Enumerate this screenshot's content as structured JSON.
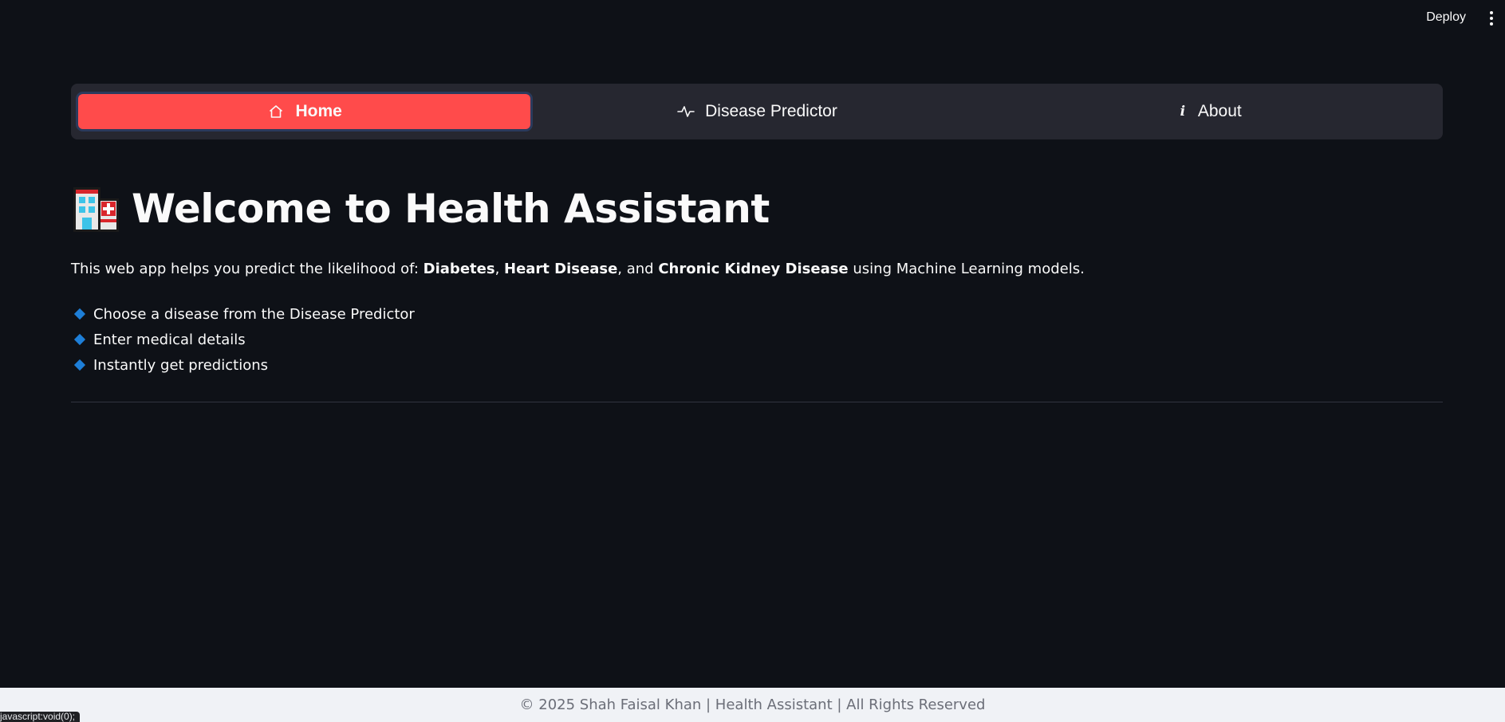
{
  "header": {
    "deploy_label": "Deploy",
    "menu_icon": "kebab-menu-icon"
  },
  "nav": {
    "items": [
      {
        "label": "Home",
        "icon": "home-icon",
        "active": true
      },
      {
        "label": "Disease Predictor",
        "icon": "activity-icon",
        "active": false
      },
      {
        "label": "About",
        "icon": "info-icon",
        "active": false
      }
    ]
  },
  "main": {
    "title": "Welcome to Health Assistant",
    "title_icon": "hospital-icon",
    "intro": {
      "prefix": "This web app helps you predict the likelihood of: ",
      "diabetes": "Diabetes",
      "sep1": ", ",
      "heart": "Heart Disease",
      "sep2": ", and ",
      "kidney": "Chronic Kidney Disease",
      "suffix": " using Machine Learning models."
    },
    "features": [
      "Choose a disease from the Disease Predictor",
      "Enter medical details",
      "Instantly get predictions"
    ]
  },
  "footer": {
    "text": "© 2025 Shah Faisal Khan | Health Assistant | All Rights Reserved"
  },
  "status_bar": {
    "url": "javascript:void(0);"
  },
  "colors": {
    "background": "#0e1117",
    "nav_background": "#262730",
    "accent": "#ff4b4b",
    "bullet": "#1e7fd8",
    "footer_background": "#f0f2f6"
  }
}
